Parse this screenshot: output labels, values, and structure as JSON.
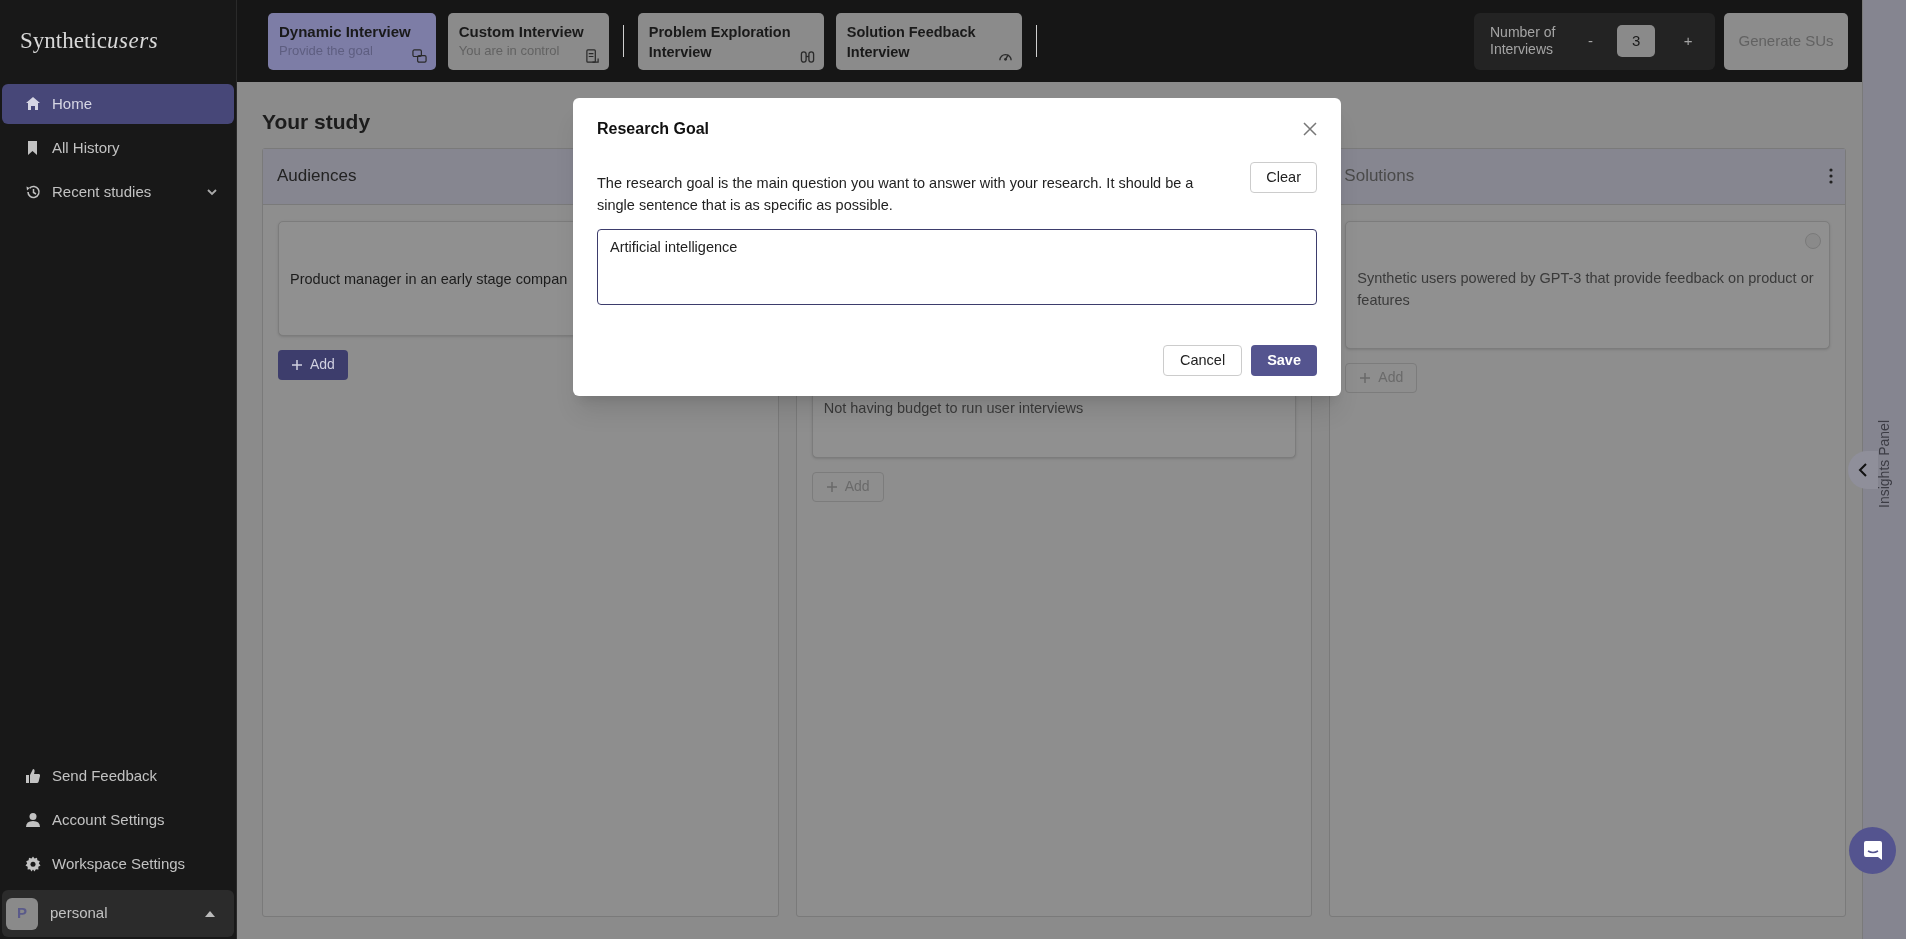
{
  "sidebar": {
    "logo": {
      "word": "Synthetic",
      "script": "users"
    },
    "nav": [
      {
        "label": "Home",
        "selected": true
      },
      {
        "label": "All History",
        "selected": false
      },
      {
        "label": "Recent studies",
        "selected": false,
        "expanded": false
      }
    ],
    "footer": [
      {
        "label": "Send Feedback"
      },
      {
        "label": "Account Settings"
      },
      {
        "label": "Workspace Settings"
      }
    ],
    "workspace": {
      "initial": "P",
      "name": "personal"
    }
  },
  "topbar": {
    "groups": [
      [
        {
          "title": "Dynamic Interview",
          "subtitle": "Provide the goal",
          "selected": true
        },
        {
          "title": "Custom Interview",
          "subtitle": "You are in control",
          "selected": false
        }
      ],
      [
        {
          "title": "Problem Exploration Interview",
          "selected": false
        },
        {
          "title": "Solution Feedback Interview",
          "selected": false
        }
      ]
    ],
    "counter": {
      "label": "Number of Interviews",
      "minus": "-",
      "value": "3",
      "plus": "+"
    },
    "generate_button": {
      "label": "Generate SUs",
      "disabled": true
    }
  },
  "main": {
    "title": "Your study",
    "columns": [
      {
        "title": "Audiences",
        "cards": [
          {
            "text": "Product manager in an early stage compan"
          }
        ],
        "add_button": {
          "label": "Add",
          "disabled": false
        }
      },
      {
        "cards": [
          {
            "text": "Not having budget to run user interviews"
          }
        ],
        "add_button": {
          "label": "Add",
          "disabled": true
        }
      },
      {
        "title": "Solutions",
        "menu": true,
        "cards": [
          {
            "text": "Synthetic users powered by GPT-3 that provide feedback on product or features",
            "selected": false
          }
        ],
        "add_button": {
          "label": "Add",
          "disabled": true
        }
      }
    ]
  },
  "insights_panel": {
    "label": "Insights Panel"
  },
  "modal": {
    "title": "Research Goal",
    "description": "The research goal is the main question you want to answer with your research. It should be a single sentence that is as specific as possible.",
    "clear_button": "Clear",
    "goal": "Artificial intelligence",
    "cancel_button": "Cancel",
    "save_button": "Save"
  }
}
